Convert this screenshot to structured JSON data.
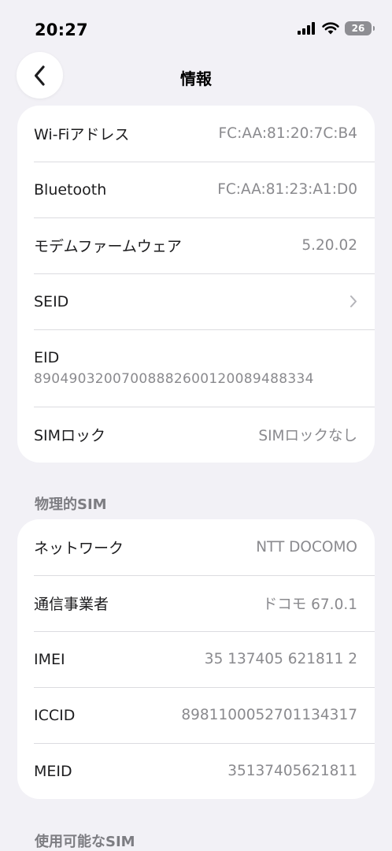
{
  "status_bar": {
    "time": "20:27",
    "battery": "26"
  },
  "nav": {
    "title": "情報"
  },
  "group1": {
    "rows": [
      {
        "label": "Wi-Fiアドレス",
        "value": "FC:AA:81:20:7C:B4"
      },
      {
        "label": "Bluetooth",
        "value": "FC:AA:81:23:A1:D0"
      },
      {
        "label": "モデムファームウェア",
        "value": "5.20.02"
      },
      {
        "label": "SEID"
      },
      {
        "label": "EID",
        "value": "89049032007008882600120089488334"
      },
      {
        "label": "SIMロック",
        "value": "SIMロックなし"
      }
    ]
  },
  "section_physical": {
    "header": "物理的SIM"
  },
  "group2": {
    "rows": [
      {
        "label": "ネットワーク",
        "value": "NTT DOCOMO"
      },
      {
        "label": "通信事業者",
        "value": "ドコモ 67.0.1"
      },
      {
        "label": "IMEI",
        "value": "35 137405 621811 2"
      },
      {
        "label": "ICCID",
        "value": "8981100052701134317"
      },
      {
        "label": "MEID",
        "value": "35137405621811"
      }
    ]
  },
  "section_available": {
    "header": "使用可能なSIM"
  },
  "icons": {
    "back": "chevron-left-icon",
    "signal": "cellular-signal-icon",
    "wifi": "wifi-icon",
    "battery": "battery-icon",
    "disclosure": "chevron-right-icon"
  },
  "colors": {
    "background": "#f2f1f6",
    "card": "#ffffff",
    "secondary_text": "#8a8a8e"
  }
}
